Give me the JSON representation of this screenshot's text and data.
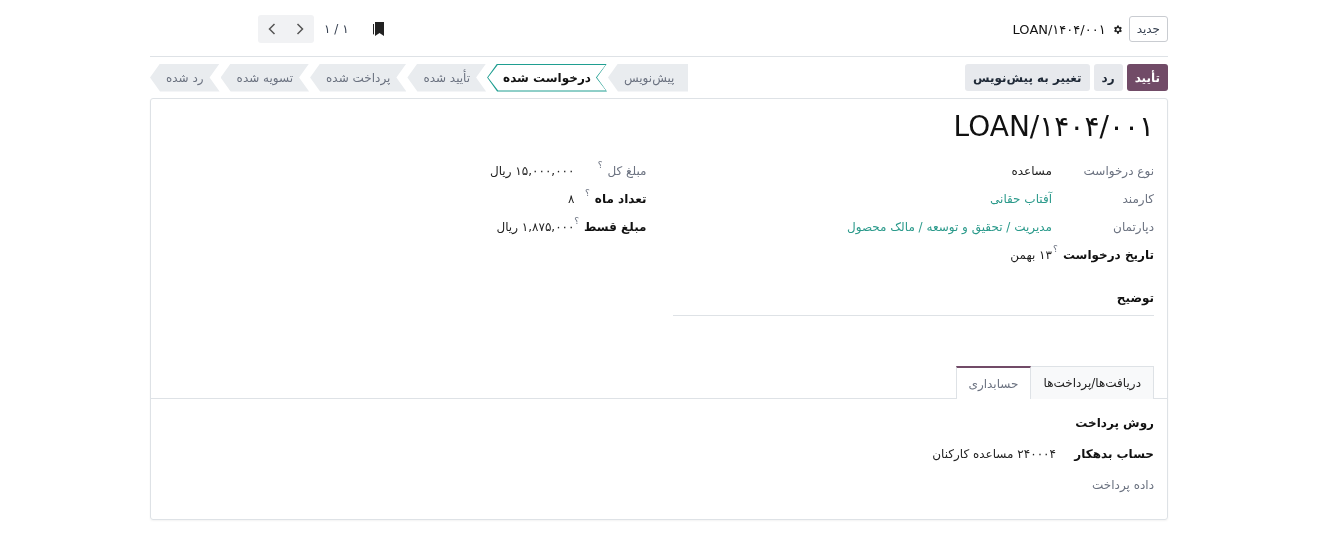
{
  "control_panel": {
    "new_button": "جدید",
    "record": "LOAN/۱۴۰۴/۰۰۱",
    "pager": "۱ / ۱"
  },
  "action_buttons": [
    {
      "label": "تأیید",
      "kind": "primary"
    },
    {
      "label": "رد",
      "kind": "secondary"
    },
    {
      "label": "تغییر به پیش‌نویس",
      "kind": "secondary"
    }
  ],
  "stages": [
    {
      "label": "پیش‌نویس",
      "selected": false
    },
    {
      "label": "درخواست شده",
      "selected": true
    },
    {
      "label": "تأیید شده",
      "selected": false
    },
    {
      "label": "پرداخت شده",
      "selected": false
    },
    {
      "label": "تسویه شده",
      "selected": false
    },
    {
      "label": "رد شده",
      "selected": false
    }
  ],
  "title": "LOAN/۱۴۰۴/۰۰۱",
  "fields_right": [
    {
      "label": "نوع درخواست",
      "value": "مساعده",
      "kind": "text",
      "required": false
    },
    {
      "label": "کارمند",
      "value": "آفتاب حقانی",
      "kind": "link",
      "required": false
    },
    {
      "label": "دپارتمان",
      "value": "مدیریت / تحقیق و توسعه / مالک محصول",
      "kind": "link",
      "required": false
    },
    {
      "label": "تاریخ درخواست",
      "tooltip": "؟",
      "value": "۱۳ بهمن",
      "kind": "text",
      "required": true
    }
  ],
  "fields_left": [
    {
      "label": "مبلغ کل",
      "tooltip": "؟",
      "value": "۱۵,۰۰۰,۰۰۰ ریال",
      "kind": "text",
      "required": false
    },
    {
      "label": "تعداد ماه",
      "tooltip": "؟",
      "value": "۸",
      "kind": "text",
      "required": true
    },
    {
      "label": "مبلغ قسط",
      "tooltip": "؟",
      "value": "۱,۸۷۵,۰۰۰ ریال",
      "kind": "text",
      "required": true
    }
  ],
  "description": {
    "label": "توضیح"
  },
  "tabs": [
    {
      "label": "دریافت‌ها/پرداخت‌ها",
      "selected": false
    },
    {
      "label": "حسابداری",
      "selected": true
    }
  ],
  "tab_fields": [
    {
      "label": "روش پرداخت",
      "required": true
    },
    {
      "label": "حساب بدهکار",
      "value": "۲۴۰۰۰۴ مساعده کارکنان",
      "kind": "text",
      "required": true
    },
    {
      "label": "داده پرداخت",
      "required": false
    }
  ]
}
